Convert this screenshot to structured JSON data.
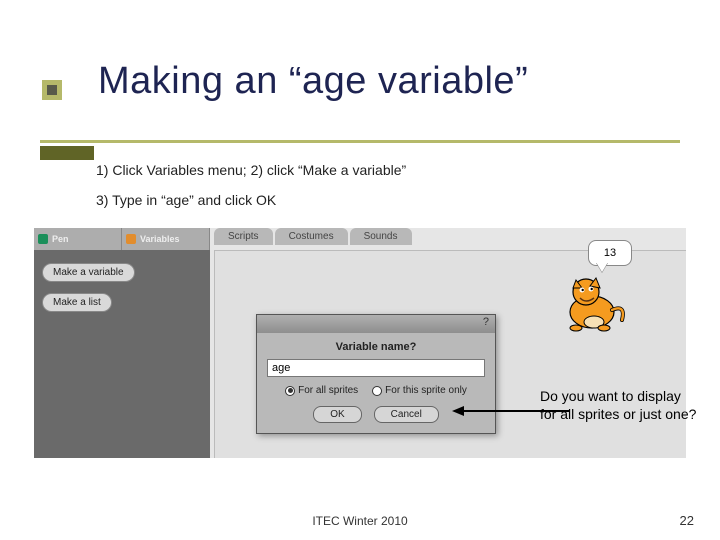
{
  "title": "Making an “age variable”",
  "steps": {
    "s1": "1)  Click Variables menu; 2) click “Make a variable”",
    "s3": "3)  Type in “age” and click OK"
  },
  "palette": {
    "pen": "Pen",
    "variables": "Variables",
    "make_var": "Make a variable",
    "make_list": "Make a list"
  },
  "tabs": {
    "scripts": "Scripts",
    "costumes": "Costumes",
    "sounds": "Sounds"
  },
  "speech": "13",
  "dialog": {
    "label": "Variable name?",
    "qmark": "?",
    "input_value": "age",
    "radio_all": "For all sprites",
    "radio_this": "For this sprite only",
    "ok": "OK",
    "cancel": "Cancel"
  },
  "callout": "Do you want to display for all sprites or just one?",
  "footer": {
    "center": "ITEC Winter 2010",
    "page": "22"
  }
}
